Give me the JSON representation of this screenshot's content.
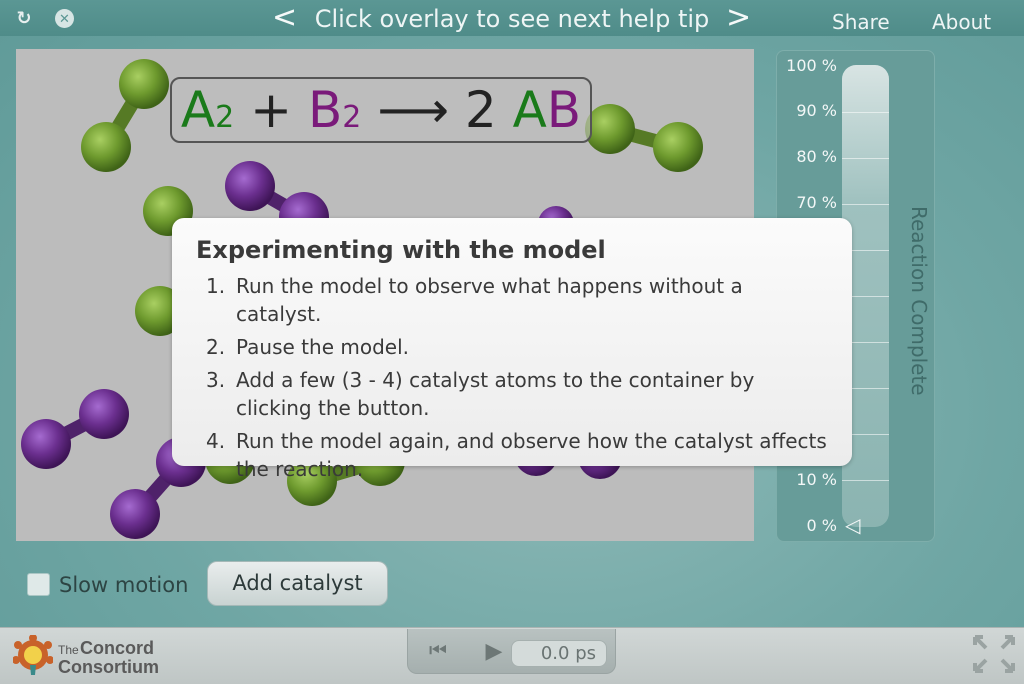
{
  "topbar": {
    "help_tip": "Click overlay to see next help tip",
    "prev_label": "<",
    "next_label": ">",
    "share": "Share",
    "about": "About",
    "reload_icon": "reload-icon",
    "close_icon": "close-icon"
  },
  "equation": {
    "a": "A",
    "a_sub": "2",
    "plus": "+",
    "b": "B",
    "b_sub": "2",
    "arrow": "⟶",
    "coef": "2",
    "prod_a": "A",
    "prod_b": "B"
  },
  "colors": {
    "green_atom": "#6e9a2e",
    "purple_atom": "#6b2f8f",
    "accent_teal": "#5b9794"
  },
  "gauge": {
    "title": "Reaction Complete",
    "labels": [
      "100 %",
      "90 %",
      "80 %",
      "70 %",
      "10 %",
      "0 %"
    ],
    "value_percent": 0
  },
  "help": {
    "title": "Experimenting with the model",
    "steps": [
      {
        "num": "1.",
        "text": "Run the model to observe what happens without a catalyst."
      },
      {
        "num": "2.",
        "text": "Pause the model."
      },
      {
        "num": "3.",
        "text": "Add a few (3 - 4) catalyst atoms to the container by clicking the button."
      },
      {
        "num": "4.",
        "text": "Run the model again, and observe how the catalyst affects the reaction."
      }
    ]
  },
  "controls": {
    "slow_motion": "Slow motion",
    "add_catalyst": "Add catalyst"
  },
  "footer": {
    "logo_the": "The",
    "logo_line1": "Concord",
    "logo_line2": "Consortium",
    "time": "0.0 ps"
  }
}
